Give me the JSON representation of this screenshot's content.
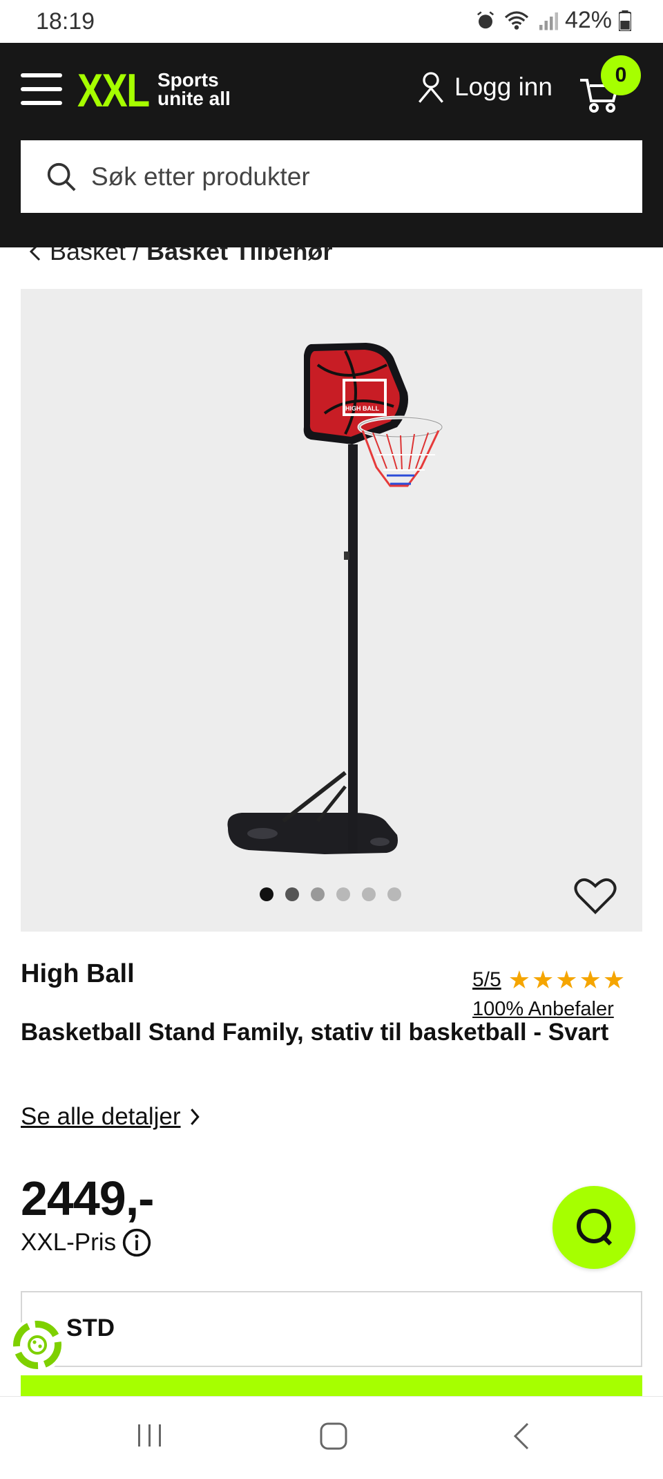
{
  "status_bar": {
    "time": "18:19",
    "battery": "42%"
  },
  "header": {
    "logo_text": "XXL",
    "logo_tagline": "Sports unite all",
    "login_label": "Logg inn",
    "cart_count": "0",
    "search_placeholder": "Søk etter produkter",
    "colors": {
      "accent": "#a6ff00",
      "background": "#171717"
    }
  },
  "breadcrumb": {
    "parent": "Basket",
    "separator": "/",
    "current": "Basket Tilbehør"
  },
  "gallery": {
    "image_count": 6,
    "active_index": 0
  },
  "product": {
    "brand": "High Ball",
    "rating_text": "5/5",
    "stars": 5,
    "recommend_text": "100% Anbefaler",
    "title": "Basketball Stand Family, stativ til basketball - Svart",
    "details_link": "Se alle detaljer",
    "price": "2449,-",
    "price_label": "XXL-Pris",
    "size_box_text": "STD"
  }
}
